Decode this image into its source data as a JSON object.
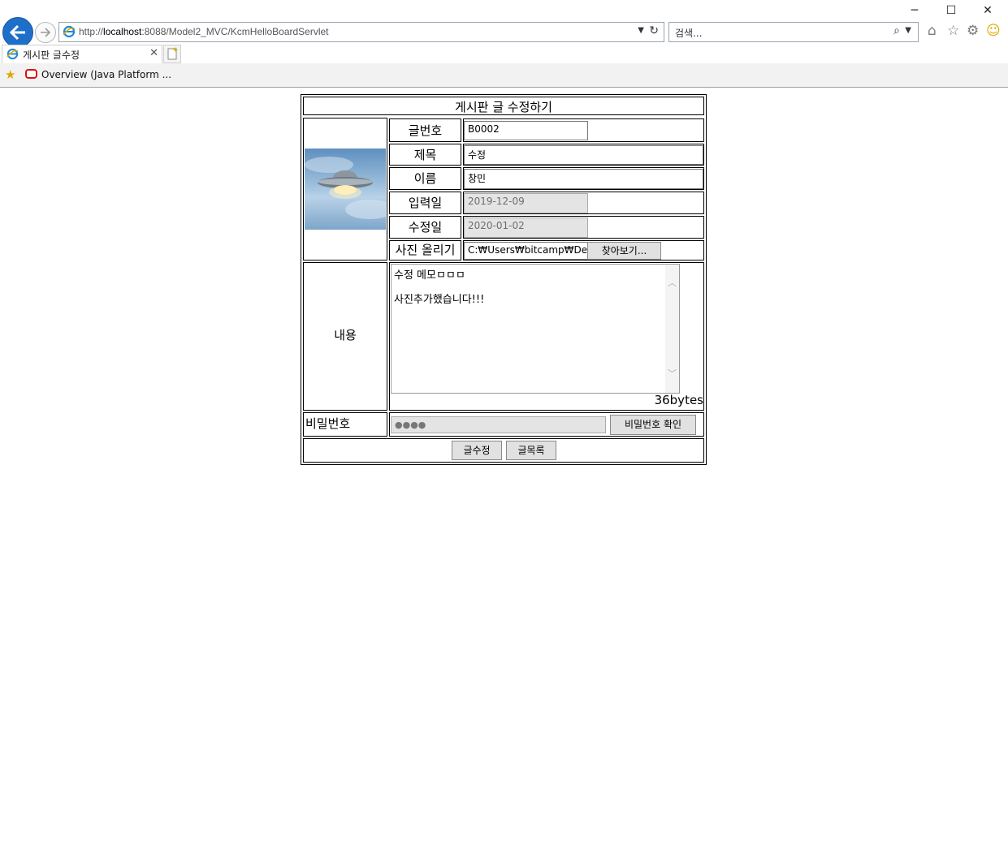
{
  "browser": {
    "url_host_prefix": "http://",
    "url_host": "localhost",
    "url_rest": ":8088/Model2_MVC/KcmHelloBoardServlet",
    "search_placeholder": "검색...",
    "tab_title": "게시판 글수정",
    "favorite_label": "Overview (Java Platform ...",
    "win_min": "─",
    "win_max": "☐",
    "win_close": "✕"
  },
  "form": {
    "heading": "게시판 글 수정하기",
    "labels": {
      "num": "글번호",
      "title": "제목",
      "name": "이름",
      "reg_date": "입력일",
      "mod_date": "수정일",
      "photo": "사진 올리기",
      "content": "내용",
      "password": "비밀번호"
    },
    "values": {
      "num": "B0002",
      "title": "수정",
      "name": "창민",
      "reg_date": "2019-12-09",
      "mod_date": "2020-01-02",
      "photo_path": "C:₩Users₩bitcamp₩Desl",
      "content_line1": "수정 메모ㅁㅁㅁ",
      "content_line2": "사진추가했습니다!!!",
      "byte_count": "36bytes",
      "password_mask": "●●●●"
    },
    "buttons": {
      "browse": "찾아보기...",
      "check_password": "비밀번호 확인",
      "submit_edit": "글수정",
      "list": "글목록"
    }
  }
}
